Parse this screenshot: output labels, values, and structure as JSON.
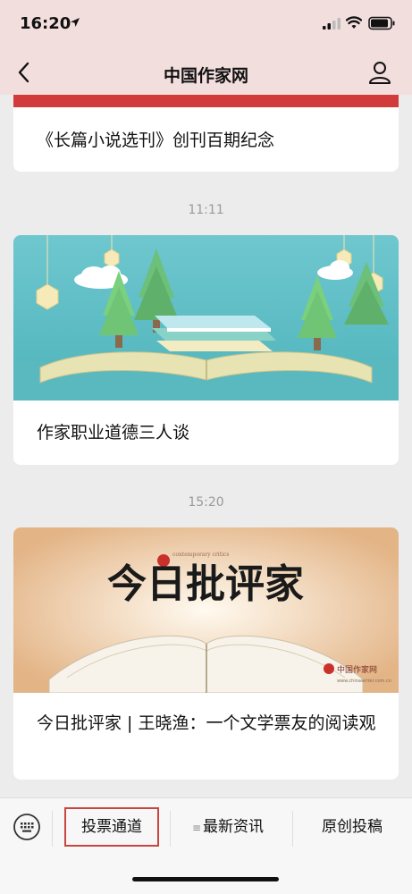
{
  "status_bar": {
    "time": "16:20",
    "icons": [
      "location-arrow-icon",
      "signal-icon",
      "wifi-icon",
      "battery-icon"
    ]
  },
  "nav": {
    "title": "中国作家网",
    "back_icon": "chevron-left-icon",
    "profile_icon": "user-icon"
  },
  "messages": [
    {
      "title": "《长篇小说选刊》创刊百期纪念"
    },
    {
      "timestamp": "11:11",
      "title": "作家职业道德三人谈",
      "cover": "open-book-forest-illustration"
    },
    {
      "timestamp": "15:20",
      "title": "今日批评家 | 王晓渔：一个文学票友的阅读观",
      "cover": "today-critic-cover",
      "cover_text": {
        "headline": "今日批评家",
        "seal_text": "contemporary critics",
        "brand": "中国作家网",
        "brand_url": "www.chinawriter.com.cn"
      }
    }
  ],
  "bottom_menu": {
    "keyboard_icon": "keyboard-icon",
    "items": [
      {
        "label": "投票通道"
      },
      {
        "label": "最新资讯",
        "icon": "menu-lines-icon"
      },
      {
        "label": "原创投稿"
      }
    ]
  },
  "colors": {
    "header_bg": "#f3dede",
    "accent_red": "#d23b3b",
    "page_bg": "#ececec"
  }
}
